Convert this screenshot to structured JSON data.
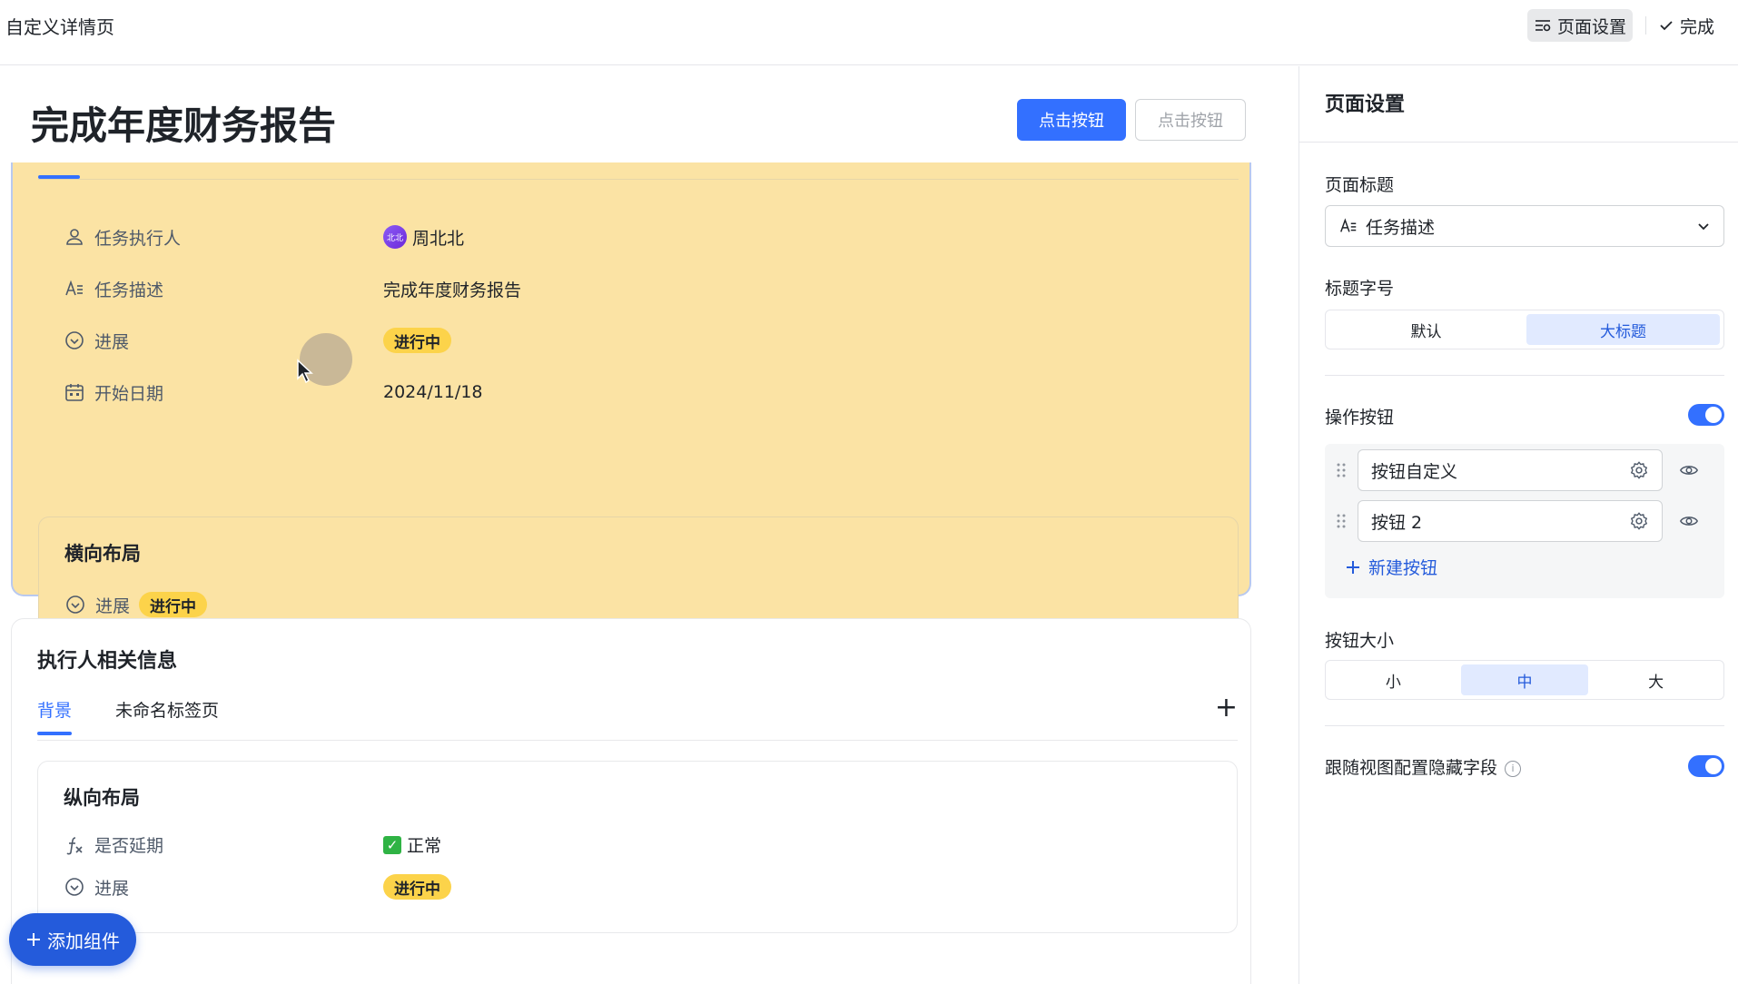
{
  "app": {
    "title": "自定义详情页"
  },
  "topbar": {
    "page_settings_label": "页面设置",
    "done_label": "完成"
  },
  "page": {
    "title": "完成年度财务报告",
    "primary_button": "点击按钮",
    "secondary_button": "点击按钮"
  },
  "details": {
    "fields": [
      {
        "label": "任务执行人",
        "value": "周北北",
        "avatar_text": "北北"
      },
      {
        "label": "任务描述",
        "value": "完成年度财务报告"
      },
      {
        "label": "进展",
        "value": "进行中"
      },
      {
        "label": "开始日期",
        "value": "2024/11/18"
      }
    ],
    "horizontal_layout": {
      "title": "横向布局",
      "field_label": "进展",
      "field_value": "进行中"
    }
  },
  "executor_section": {
    "title": "执行人相关信息",
    "tabs": [
      "背景",
      "未命名标签页"
    ],
    "add_tab_symbol": "+",
    "vertical_layout": {
      "title": "纵向布局",
      "rows": [
        {
          "label": "是否延期",
          "value": "正常"
        },
        {
          "label": "进展",
          "value": "进行中"
        }
      ]
    }
  },
  "fab": {
    "label": "添加组件"
  },
  "settings_panel": {
    "title": "页面设置",
    "page_title_label": "页面标题",
    "page_title_value": "任务描述",
    "title_size_label": "标题字号",
    "title_size_options": [
      "默认",
      "大标题"
    ],
    "title_size_selected": "大标题",
    "action_buttons_label": "操作按钮",
    "action_buttons_enabled": true,
    "buttons": [
      "按钮自定义",
      "按钮 2"
    ],
    "new_button_label": "新建按钮",
    "button_size_label": "按钮大小",
    "button_size_options": [
      "小",
      "中",
      "大"
    ],
    "button_size_selected": "中",
    "hide_fields_label": "跟随视图配置隐藏字段",
    "hide_fields_enabled": true
  },
  "colors": {
    "accent": "#3370ff",
    "highlight": "#fbe3a4",
    "badge": "#fcd34a"
  },
  "icons": {
    "person": "person-icon",
    "text": "text-icon",
    "progress": "progress-icon",
    "calendar": "calendar-icon",
    "formula": "formula-icon"
  }
}
